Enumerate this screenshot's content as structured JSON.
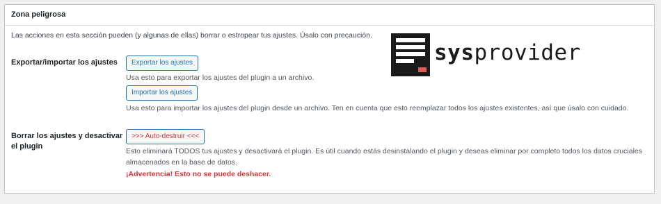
{
  "section": {
    "title": "Zona peligrosa",
    "intro": "Las acciones en esta sección pueden (y algunas de ellas) borrar o estropear tus ajustes. Úsalo con precaución."
  },
  "export_import": {
    "label": "Exportar/importar los ajustes",
    "export_button": "Exportar los ajustes",
    "export_desc": "Usa esto para exportar los ajustes del plugin a un archivo.",
    "import_button": "Importar los ajustes",
    "import_desc": "Usa esto para importar los ajustes del plugin desde un archivo. Ten en cuenta que esto reemplazar todos los ajustes existentes, así que úsalo con cuidado."
  },
  "reset": {
    "label_line1": "Borrar los ajustes y desactivar",
    "label_line2": "el plugin",
    "button": ">>> Auto-destruir <<<",
    "desc_line1": "Esto eliminará TODOS tus ajustes y desactivará el plugin. Es útil cuando estás desinstalando el plugin y deseas eliminar por completo todos los datos cruciales",
    "desc_line2": "almacenados en la base de datos.",
    "warning": "¡Advertencia! Esto no se puede deshacer."
  },
  "logo": {
    "text_bold": "sys",
    "text_light": "provider"
  },
  "colors": {
    "accent": "#2271b1",
    "danger": "#d63638",
    "panel_bg": "#ffffff",
    "page_bg": "#f0f0f1"
  }
}
